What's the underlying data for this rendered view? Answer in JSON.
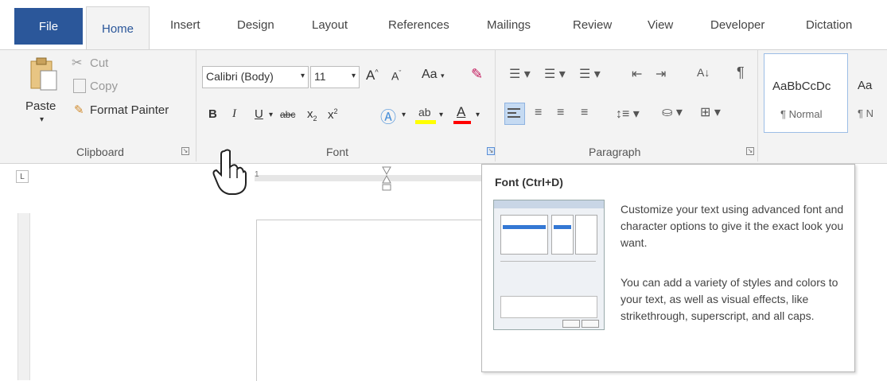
{
  "tabs": [
    "File",
    "Home",
    "Insert",
    "Design",
    "Layout",
    "References",
    "Mailings",
    "Review",
    "View",
    "Developer",
    "Dictation"
  ],
  "clipboard": {
    "paste_label": "Paste",
    "cut_label": "Cut",
    "copy_label": "Copy",
    "format_painter_label": "Format Painter",
    "group_label": "Clipboard"
  },
  "font": {
    "font_name": "Calibri (Body)",
    "font_size": "11",
    "grow_glyph": "A",
    "shrink_glyph": "A",
    "change_case": "Aa",
    "bold": "B",
    "italic": "I",
    "underline": "U",
    "strikethrough": "abc",
    "subscript": "x",
    "superscript": "x",
    "group_label": "Font"
  },
  "paragraph": {
    "group_label": "Paragraph",
    "sort_glyph": "A↓",
    "pilcrow": "¶"
  },
  "styles": {
    "preview1": "AaBbCcDc",
    "name1": "¶ Normal",
    "preview2": "Aa",
    "name2": "¶ N"
  },
  "tooltip": {
    "title": "Font (Ctrl+D)",
    "text1": "Customize your text using advanced font and character options to give it the exact look you want.",
    "text2": "You can add a variety of styles and colors to your text, as well as visual effects, like strikethrough, superscript, and all caps."
  },
  "ruler": {
    "tab_selector": "L",
    "marker": "1"
  },
  "colors": {
    "file_tab": "#2b579a",
    "ribbon_bg": "#f3f3f3",
    "highlight": "#ffff00",
    "font_color": "#ff0000"
  }
}
